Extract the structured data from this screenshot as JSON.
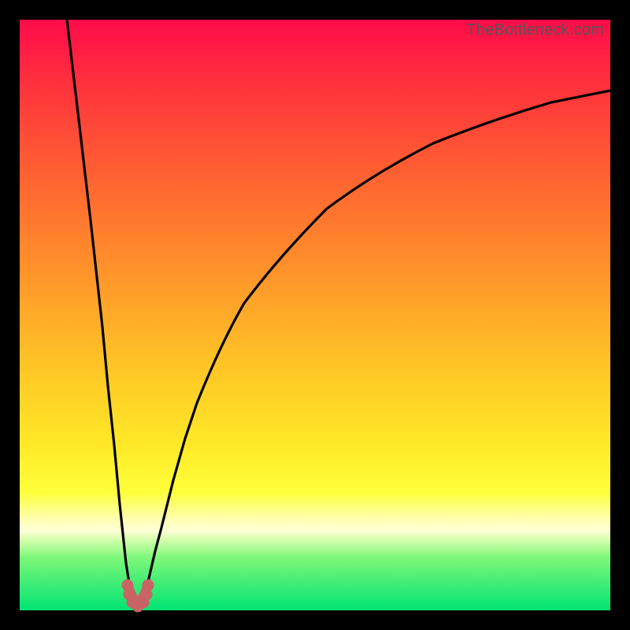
{
  "watermark": "TheBottleneck.com",
  "chart_data": {
    "type": "line",
    "title": "",
    "xlabel": "",
    "ylabel": "",
    "xlim": [
      0,
      100
    ],
    "ylim": [
      0,
      100
    ],
    "grid": false,
    "background_gradient_note": "vertical color bar from red (top, high bottleneck) to green (bottom, 0% bottleneck)",
    "series": [
      {
        "name": "bottleneck-curve",
        "color": "#000000",
        "x": [
          8,
          10,
          12,
          14,
          15,
          16,
          17,
          18,
          19,
          20,
          21,
          22,
          23,
          24,
          26,
          28,
          30,
          34,
          38,
          44,
          52,
          60,
          70,
          80,
          90,
          100
        ],
        "y": [
          100,
          83,
          66,
          48,
          38,
          28,
          18,
          8,
          2,
          0,
          2,
          6,
          10,
          14,
          22,
          29,
          35,
          45,
          52,
          60,
          68,
          74,
          79,
          83,
          86,
          88
        ]
      },
      {
        "name": "current-position-marker",
        "color": "#cc5a5a",
        "note": "salmon U-shaped marker at curve minimum",
        "x": [
          18.5,
          19,
          19.5,
          20,
          20.5,
          21,
          21.5
        ],
        "y": [
          3,
          1,
          0,
          0,
          0,
          1,
          3
        ]
      }
    ],
    "minimum": {
      "x": 20,
      "y": 0
    }
  }
}
